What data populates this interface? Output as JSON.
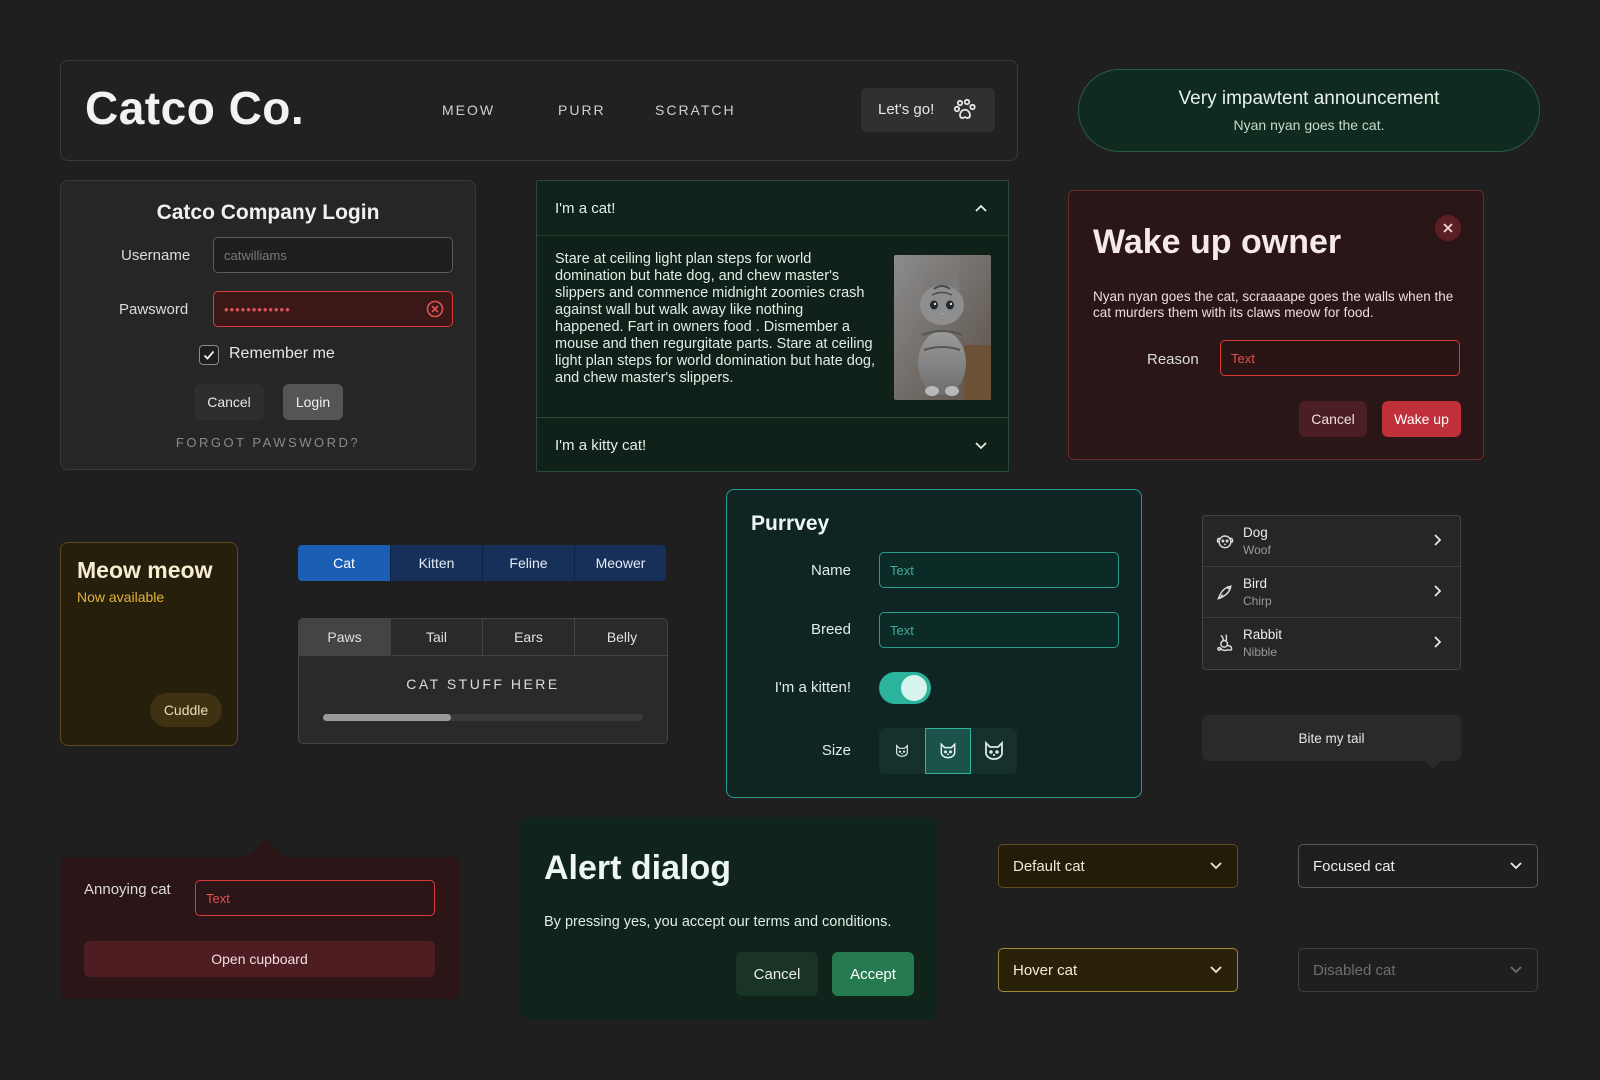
{
  "header": {
    "logo": "Catco Co.",
    "nav": [
      "MEOW",
      "PURR",
      "SCRATCH"
    ],
    "cta_label": "Let's go!"
  },
  "announcement": {
    "title": "Very impawtent announcement",
    "subtitle": "Nyan nyan goes the cat."
  },
  "login": {
    "title": "Catco Company Login",
    "username_label": "Username",
    "username_placeholder": "catwilliams",
    "password_label": "Pawsword",
    "password_value": "••••••••••••",
    "remember_label": "Remember me",
    "remember_checked": true,
    "cancel_label": "Cancel",
    "login_label": "Login",
    "forgot_label": "FORGOT PAWSWORD?"
  },
  "accordion": {
    "items": [
      {
        "label": "I'm a cat!",
        "expanded": true,
        "body": "Stare at ceiling light plan steps for world domination but hate dog, and chew master's slippers and commence midnight zoomies crash against wall but walk away like nothing happened. Fart in owners food . Dismember a mouse and then regurgitate parts. Stare at ceiling light plan steps for world domination but hate dog, and chew master's slippers."
      },
      {
        "label": "I'm a kitty cat!",
        "expanded": false
      }
    ]
  },
  "wake_dialog": {
    "title": "Wake up owner",
    "description": "Nyan nyan goes the cat, scraaaape goes the walls when the cat murders them with its claws meow for food.",
    "reason_label": "Reason",
    "reason_placeholder": "Text",
    "cancel_label": "Cancel",
    "confirm_label": "Wake up"
  },
  "meow_card": {
    "title": "Meow meow",
    "subtitle": "Now available",
    "action_label": "Cuddle"
  },
  "segmented": {
    "options": [
      "Cat",
      "Kitten",
      "Feline",
      "Meower"
    ],
    "selected": "Cat"
  },
  "tabs": {
    "items": [
      "Paws",
      "Tail",
      "Ears",
      "Belly"
    ],
    "selected": "Paws",
    "content": "CAT STUFF HERE",
    "progress": 0.4
  },
  "purrvey": {
    "title": "Purrvey",
    "name_label": "Name",
    "name_placeholder": "Text",
    "breed_label": "Breed",
    "breed_placeholder": "Text",
    "kitten_label": "I'm a kitten!",
    "kitten_on": true,
    "size_label": "Size",
    "size_selected": "medium"
  },
  "animal_list": [
    {
      "title": "Dog",
      "subtitle": "Woof",
      "icon": "dog-icon"
    },
    {
      "title": "Bird",
      "subtitle": "Chirp",
      "icon": "bird-icon"
    },
    {
      "title": "Rabbit",
      "subtitle": "Nibble",
      "icon": "rabbit-icon"
    }
  ],
  "tooltip": {
    "label": "Bite my tail"
  },
  "popover": {
    "field_label": "Annoying cat",
    "field_placeholder": "Text",
    "button_label": "Open cupboard"
  },
  "alert": {
    "title": "Alert dialog",
    "description": "By pressing yes, you accept our terms and conditions.",
    "cancel_label": "Cancel",
    "accept_label": "Accept"
  },
  "selects": {
    "default_label": "Default cat",
    "focused_label": "Focused cat",
    "hover_label": "Hover cat",
    "disabled_label": "Disabled cat"
  },
  "colors": {
    "background": "#1f1f1f",
    "accent_teal": "#2bb39b",
    "danger": "#c0303a",
    "blue_selected": "#1a5fb4",
    "amber": "#e2b33a"
  }
}
